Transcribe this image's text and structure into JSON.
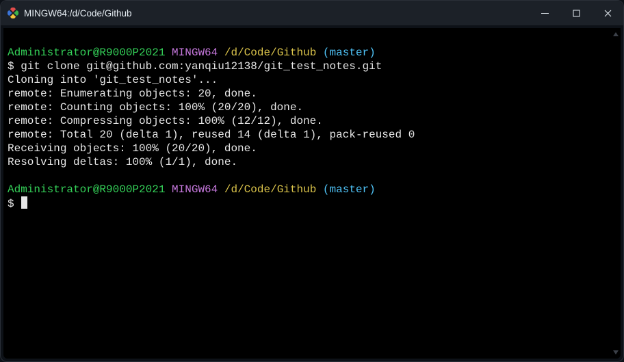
{
  "titlebar": {
    "title": "MINGW64:/d/Code/Github"
  },
  "prompt1": {
    "userhost": "Administrator@R9000P2021",
    "shell": "MINGW64",
    "path": "/d/Code/Github",
    "branch": "(master)"
  },
  "command1": {
    "symbol": "$",
    "text": "git clone git@github.com:yanqiu12138/git_test_notes.git"
  },
  "output": {
    "l1": "Cloning into 'git_test_notes'...",
    "l2": "remote: Enumerating objects: 20, done.",
    "l3": "remote: Counting objects: 100% (20/20), done.",
    "l4": "remote: Compressing objects: 100% (12/12), done.",
    "l5": "remote: Total 20 (delta 1), reused 14 (delta 1), pack-reused 0",
    "l6": "Receiving objects: 100% (20/20), done.",
    "l7": "Resolving deltas: 100% (1/1), done."
  },
  "prompt2": {
    "userhost": "Administrator@R9000P2021",
    "shell": "MINGW64",
    "path": "/d/Code/Github",
    "branch": "(master)"
  },
  "command2": {
    "symbol": "$"
  }
}
